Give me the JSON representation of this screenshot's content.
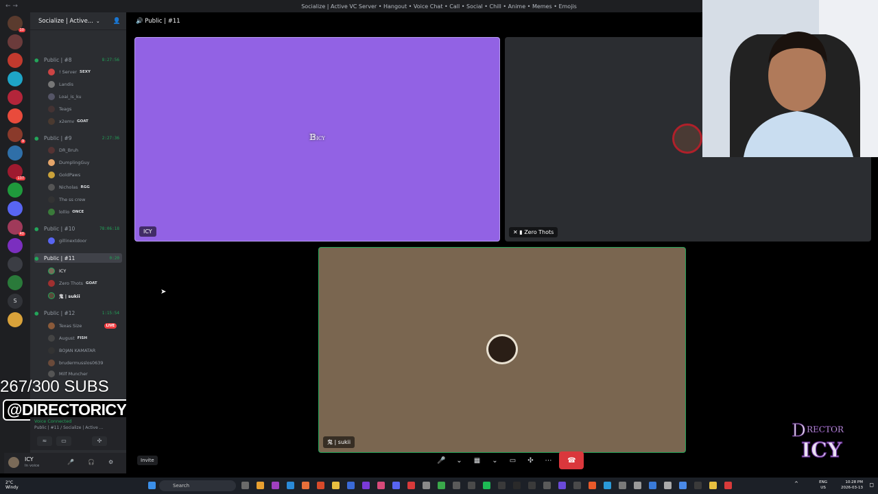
{
  "window": {
    "title": "Socialize | Active VC Server • Hangout • Voice Chat • Call • Social • Chill • Anime • Memes • Emojis"
  },
  "guild": {
    "name": "Socialize | Active..."
  },
  "server_badges": [
    "10",
    "9",
    "137",
    "40"
  ],
  "voice_channels": [
    {
      "name": "Public | #8",
      "time": "8:27:56"
    },
    {
      "name": "Public | #9",
      "time": "2:27:36"
    },
    {
      "name": "Public | #10",
      "time": "78:06:18"
    },
    {
      "name": "Public | #11",
      "time": "0:20"
    },
    {
      "name": "Public | #12",
      "time": "1:15:54"
    }
  ],
  "members": [
    {
      "name": "! Server",
      "tag": "SEXY"
    },
    {
      "name": "Landis",
      "tag": ""
    },
    {
      "name": "Loai_is_ku",
      "tag": ""
    },
    {
      "name": "Teags",
      "tag": ""
    },
    {
      "name": "x2emv",
      "tag": "GOAT"
    },
    {
      "name": "DR_Bruh",
      "tag": ""
    },
    {
      "name": "DumplingGuy",
      "tag": ""
    },
    {
      "name": "GoldPaws",
      "tag": ""
    },
    {
      "name": "Nicholas",
      "tag": "RGG"
    },
    {
      "name": "The ss crew",
      "tag": ""
    },
    {
      "name": "lollio",
      "tag": "ONCE"
    },
    {
      "name": "gillinextdoor",
      "tag": ""
    },
    {
      "name": "ICY",
      "tag": ""
    },
    {
      "name": "Zero Thots",
      "tag": "GOAT"
    },
    {
      "name": "鬼 | sukii",
      "tag": ""
    },
    {
      "name": "Texas Size",
      "tag": "",
      "live": "LIVE"
    },
    {
      "name": "August",
      "tag": "FISH"
    },
    {
      "name": "BOJAN KAMATAR",
      "tag": ""
    },
    {
      "name": "brudermusslos0639",
      "tag": ""
    },
    {
      "name": "Milf Muncher",
      "tag": ""
    }
  ],
  "overlay": {
    "subs": "267/300 SUBS",
    "handle": "@DIRECTORICY",
    "logo_text": "DIRECTOR ICY"
  },
  "voice_status": {
    "connected": "Voice Connected",
    "channel": "Public | #11 / Socialize | Active ..."
  },
  "user": {
    "name": "ICY",
    "status": "In voice"
  },
  "stage": {
    "channel": "Public | #11",
    "tiles": [
      {
        "label": "ICY",
        "bg": "#9262e4"
      },
      {
        "label": "Zero Thots",
        "bg": "#2b2d31"
      },
      {
        "label": "鬼 | sukii",
        "bg": "#7a6650"
      }
    ],
    "invite": "Invite"
  },
  "taskbar": {
    "weather_temp": "2°C",
    "weather_desc": "Windy",
    "search": "Search",
    "lang": "ENG",
    "region": "US",
    "time": "10:28 PM",
    "date": "2026-03-13"
  }
}
